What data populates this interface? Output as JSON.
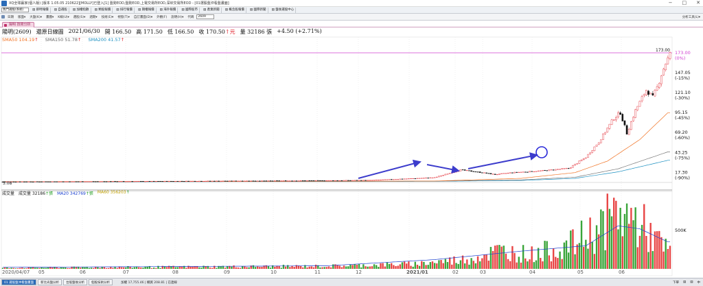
{
  "window": {
    "title": "XQ全球贏家(個人版) [版本 1.05.05 210622][MOLLY]已登入[1] 盤勢EOD,盤勢EOD,上電交易所EOD,深圳交易所EOD - [01選股盤沖看盤畫面]",
    "controls": [
      "−",
      "□",
      "✕"
    ]
  },
  "navbar": {
    "combo": "我門選股(系統)",
    "items": [
      "▤ 即時報價",
      "▤ 自選股",
      "▤ 加權指數",
      "▤ 類股報價",
      "▤ 排行報價",
      "▤ 期權報價",
      "▤ 海外報價",
      "▤ 國際股市",
      "▤ 產業新聞",
      "▤ 概念股報價",
      "▤ 國際新聞",
      "▤ 盤後選股中心"
    ]
  },
  "toolbar": {
    "items": [
      "日期",
      "版面▾",
      "大盤(K)▾",
      "畫圖▾",
      "K線(U)▾",
      "選股(S)▾",
      "週期▾",
      "技術(E)▾",
      "視窗(T)▾",
      "自訂畫面(D)▾",
      "外觀(F)",
      "說明(H)▾"
    ],
    "code_label": "代碼",
    "code_value": "2609",
    "right_label": "分析工具(L)▾"
  },
  "tab": {
    "label": "陽明 技術分析"
  },
  "quote": {
    "name": "陽明(2609)",
    "period": "還原日線圖",
    "date": "2021/06/30",
    "open_label": "開",
    "open": "166.50",
    "high_label": "高",
    "high": "171.50",
    "low_label": "低",
    "low": "166.50",
    "close_label": "收",
    "close": "170.50",
    "unit_arrow": "↑元",
    "vol_label": "量",
    "volume": "32186",
    "vol_unit": "張",
    "change": "+4.50 (+2.71%)"
  },
  "ma_legend": {
    "sma50_label": "SMA50",
    "sma50_value": "104.19",
    "sma150_label": "SMA150",
    "sma150_value": "51.78",
    "sma200_label": "SMA200",
    "sma200_value": "41.57",
    "arrow": "↑"
  },
  "volume_legend": {
    "title": "成交量",
    "vol_label": "成交量",
    "vol_value": "32186",
    "ma20_label": "MA20",
    "ma20_value": "342769",
    "ma60_label": "MA60",
    "ma60_value": "356203",
    "arrow": "↑張",
    "arrow_plain": "↑"
  },
  "colors": {
    "up": "#e0202a",
    "down": "#111111",
    "sma50": "#f07020",
    "sma150": "#777777",
    "sma200": "#1a8fc0",
    "arrows": "#3c3ccc",
    "vol_up": "#e84545",
    "vol_down": "#3aa53a",
    "highlight": "#d040d0"
  },
  "chart_data": {
    "type": "candlestick",
    "symbol": "陽明(2609)",
    "price_axis_ticks": [
      {
        "value": 173.0,
        "label": "173.00",
        "pct": "(0%)"
      },
      {
        "value": 147.05,
        "label": "147.05",
        "pct": "(-15%)"
      },
      {
        "value": 121.1,
        "label": "121.10",
        "pct": "(-30%)"
      },
      {
        "value": 95.15,
        "label": "95.15",
        "pct": "(-45%)"
      },
      {
        "value": 69.2,
        "label": "69.20",
        "pct": "(-60%)"
      },
      {
        "value": 43.25,
        "label": "43.25",
        "pct": "(-75%)"
      },
      {
        "value": 17.3,
        "label": "17.30",
        "pct": "(-90%)"
      }
    ],
    "price_range": [
      5.08,
      173.0
    ],
    "high_marker": "173.00",
    "low_marker": "5.08",
    "x_ticks": [
      "2020/04/07",
      "05",
      "06",
      "07",
      "08",
      "09",
      "10",
      "11",
      "12",
      "2021/01",
      "02",
      "03",
      "04",
      "05",
      "06"
    ],
    "volume_axis_tick": "500K",
    "price_keypoints": [
      [
        "2020/04/07",
        5.1
      ],
      [
        "2020/06",
        5.4
      ],
      [
        "2020/08",
        5.8
      ],
      [
        "2020/10",
        6.3
      ],
      [
        "2020/11",
        7.0
      ],
      [
        "2020/12",
        10.5
      ],
      [
        "2021/01/05",
        20.5
      ],
      [
        "2021/01/20",
        17.0
      ],
      [
        "2021/02/05",
        14.5
      ],
      [
        "2021/02/20",
        17.0
      ],
      [
        "2021/03/10",
        19.0
      ],
      [
        "2021/03/31",
        22.5
      ],
      [
        "2021/04/08",
        29.5
      ],
      [
        "2021/04/15",
        37.0
      ],
      [
        "2021/04/25",
        57.0
      ],
      [
        "2021/05/05",
        88.0
      ],
      [
        "2021/05/10",
        95.0
      ],
      [
        "2021/05/15",
        68.0
      ],
      [
        "2021/05/25",
        98.0
      ],
      [
        "2021/06/05",
        125.0
      ],
      [
        "2021/06/12",
        115.0
      ],
      [
        "2021/06/18",
        128.0
      ],
      [
        "2021/06/22",
        145.0
      ],
      [
        "2021/06/26",
        160.0
      ],
      [
        "2021/06/30",
        170.5
      ]
    ],
    "sma50_keypoints": [
      [
        0,
        5.2
      ],
      [
        200,
        6.0
      ],
      [
        240,
        9.5
      ],
      [
        265,
        17.0
      ],
      [
        280,
        32.0
      ],
      [
        295,
        60.0
      ],
      [
        308,
        95.0
      ]
    ],
    "sma150_keypoints": [
      [
        0,
        5.1
      ],
      [
        200,
        5.8
      ],
      [
        240,
        7.5
      ],
      [
        265,
        11.0
      ],
      [
        285,
        22.0
      ],
      [
        308,
        44.0
      ]
    ],
    "sma200_keypoints": [
      [
        0,
        5.0
      ],
      [
        200,
        5.6
      ],
      [
        240,
        6.8
      ],
      [
        265,
        9.5
      ],
      [
        285,
        18.0
      ],
      [
        308,
        33.0
      ]
    ],
    "volume_keypoints": [
      [
        0,
        15
      ],
      [
        150,
        40
      ],
      [
        190,
        70
      ],
      [
        215,
        140
      ],
      [
        230,
        260
      ],
      [
        245,
        210
      ],
      [
        262,
        330
      ],
      [
        275,
        560
      ],
      [
        285,
        800
      ],
      [
        295,
        650
      ],
      [
        308,
        250
      ]
    ],
    "ma20_keypoints": [
      [
        0,
        20
      ],
      [
        150,
        40
      ],
      [
        200,
        120
      ],
      [
        240,
        230
      ],
      [
        270,
        300
      ],
      [
        285,
        560
      ],
      [
        295,
        520
      ],
      [
        308,
        350
      ]
    ]
  }
}
